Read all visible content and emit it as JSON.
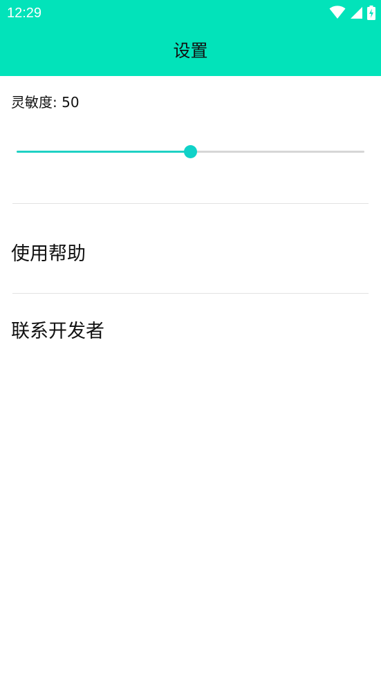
{
  "status_bar": {
    "time": "12:29",
    "icons": [
      "wifi-icon",
      "signal-icon",
      "battery-charging-icon"
    ]
  },
  "header": {
    "title": "设置",
    "background_color": "#02E3BA"
  },
  "sensitivity": {
    "label": "灵敏度: 50",
    "value": 50,
    "min": 0,
    "max": 100,
    "accent_color": "#10D2C8"
  },
  "menu": {
    "items": [
      {
        "label": "使用帮助"
      },
      {
        "label": "联系开发者"
      }
    ]
  }
}
